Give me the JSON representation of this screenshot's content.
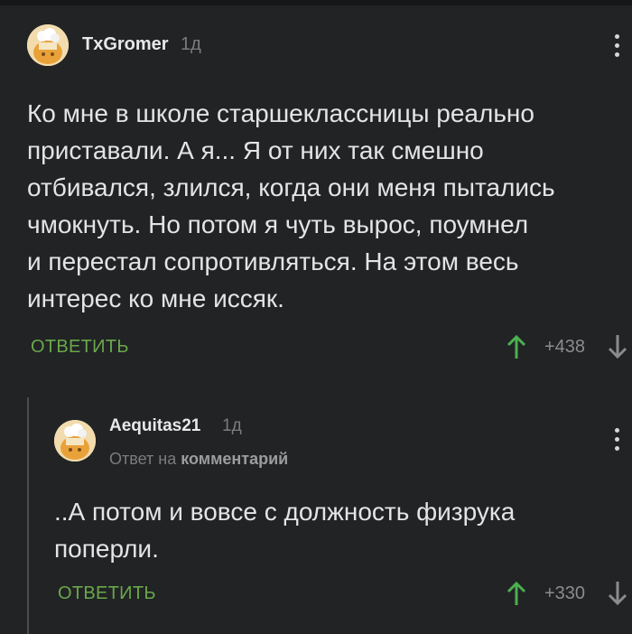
{
  "comments": [
    {
      "author": "TxGromer",
      "time": "1д",
      "text_lines": [
        "Ко мне в школе старшеклассницы реально",
        "приставали. А я... Я от них так смешно",
        "отбивался, злился, когда они меня пытались",
        "чмокнуть. Но потом я чуть вырос, поумнел",
        "и перестал сопротивляться. На этом весь",
        "интерес ко мне иссяк."
      ],
      "reply_label": "ОТВЕТИТЬ",
      "rating": "+438"
    },
    {
      "author": "Aequitas21",
      "time": "1д",
      "reply_to_prefix": "Ответ на",
      "reply_to_link": "комментарий",
      "text_lines": [
        "..А потом и вовсе с должность физрука",
        "поперли."
      ],
      "reply_label": "ОТВЕТИТЬ",
      "rating": "+330"
    }
  ],
  "colors": {
    "background": "#212325",
    "accent_reply": "#6aa84a",
    "upvote": "#4caf50",
    "downvote": "#8a8c8e"
  },
  "icons": [
    "avatar-image",
    "more-vertical-icon",
    "arrow-up-icon",
    "arrow-down-icon"
  ]
}
